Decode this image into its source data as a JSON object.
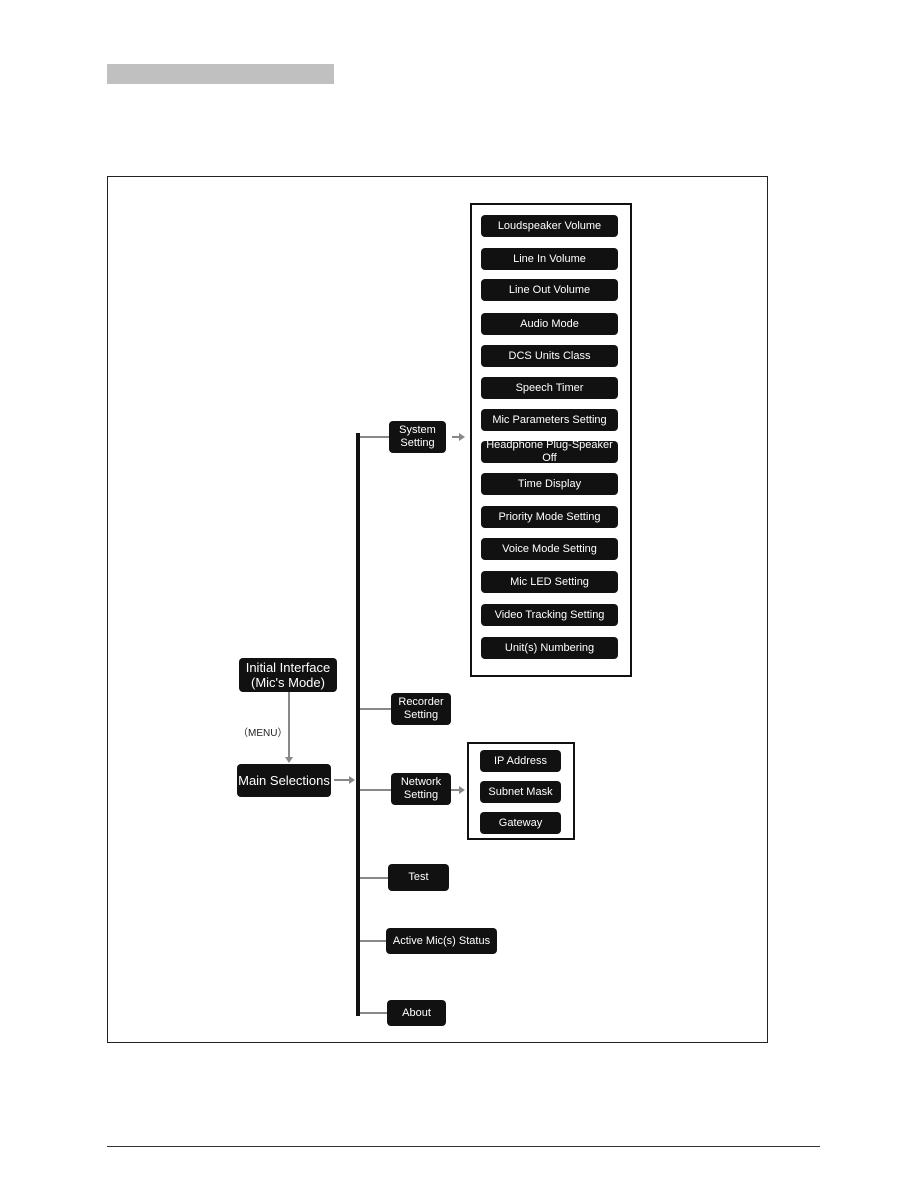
{
  "diagram": {
    "root": "Initial Interface\n(Mic's Mode)",
    "menu_label": "（MENU）",
    "main": "Main Selections",
    "branches": {
      "system": "System\nSetting",
      "recorder": "Recorder\nSetting",
      "network": "Network\nSetting",
      "test": "Test",
      "active": "Active Mic(s) Status",
      "about": "About"
    },
    "system_items": [
      "Loudspeaker Volume",
      "Line In Volume",
      "Line Out Volume",
      "Audio Mode",
      "DCS Units Class",
      "Speech Timer",
      "Mic Parameters Setting",
      "Headphone Plug-Speaker Off",
      "Time Display",
      "Priority Mode Setting",
      "Voice Mode Setting",
      "Mic LED Setting",
      "Video Tracking Setting",
      "Unit(s) Numbering"
    ],
    "network_items": [
      "IP Address",
      "Subnet Mask",
      "Gateway"
    ]
  }
}
